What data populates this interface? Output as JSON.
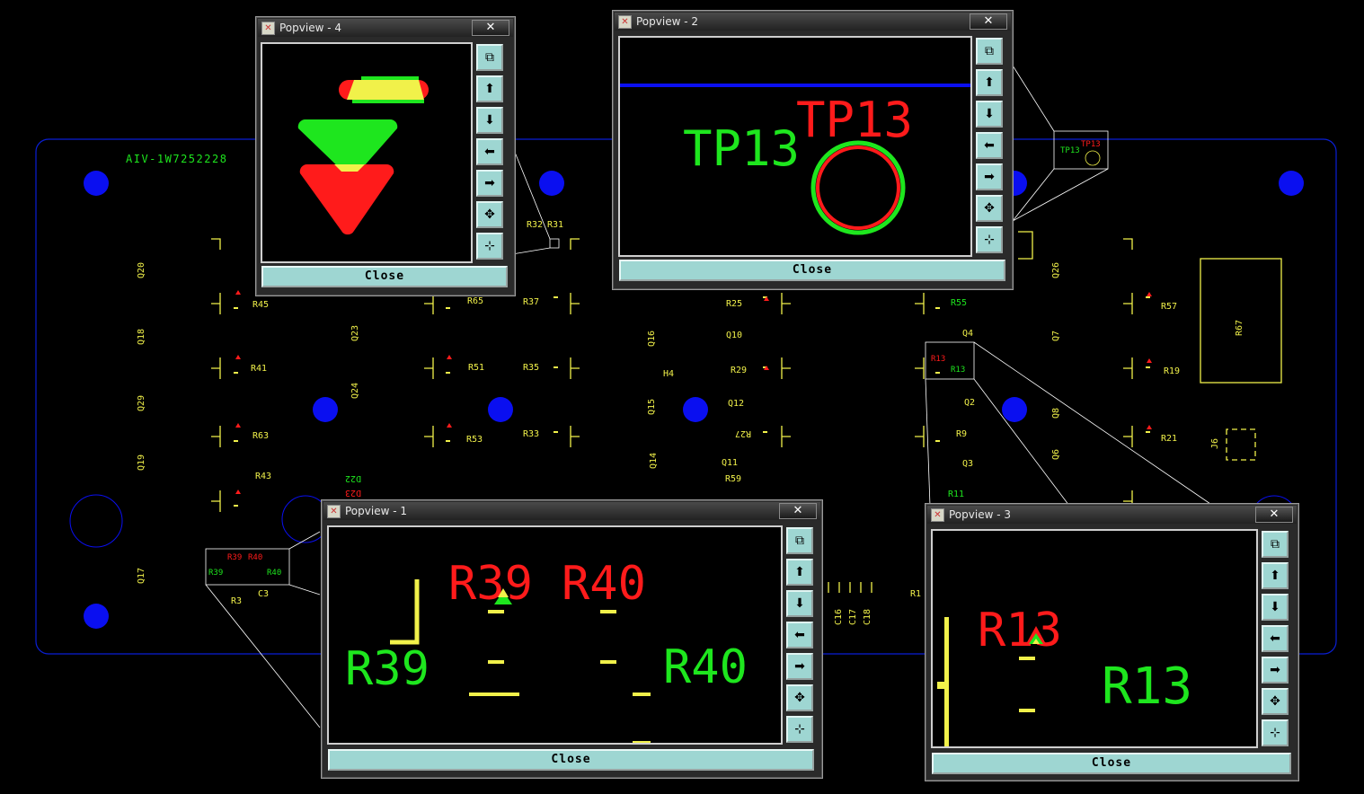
{
  "colors": {
    "outline": "#0a1fd6",
    "silk": "#f1f14a",
    "green": "#1ee61e",
    "red": "#ff1b1b",
    "blue": "#0a0ff0",
    "white": "#ffffff",
    "btn": "#9ed6d2"
  },
  "board": {
    "part_number": "AIV-1W7252228",
    "labels": [
      {
        "t": "Q20",
        "rot": true
      },
      {
        "t": "Q18",
        "rot": true
      },
      {
        "t": "Q29",
        "rot": true
      },
      {
        "t": "Q19",
        "rot": true
      },
      {
        "t": "Q17",
        "rot": true
      },
      {
        "t": "R45"
      },
      {
        "t": "R41"
      },
      {
        "t": "R63"
      },
      {
        "t": "R43"
      },
      {
        "t": "Q23",
        "rot": true
      },
      {
        "t": "Q24",
        "rot": true
      },
      {
        "t": "R65"
      },
      {
        "t": "R51"
      },
      {
        "t": "R53"
      },
      {
        "t": "R37"
      },
      {
        "t": "R35"
      },
      {
        "t": "R33"
      },
      {
        "t": "Q16",
        "rot": true
      },
      {
        "t": "Q15",
        "rot": true
      },
      {
        "t": "Q14",
        "rot": true
      },
      {
        "t": "H4"
      },
      {
        "t": "R25"
      },
      {
        "t": "Q10"
      },
      {
        "t": "R29"
      },
      {
        "t": "Q12"
      },
      {
        "t": "R27"
      },
      {
        "t": "Q11"
      },
      {
        "t": "R59"
      },
      {
        "t": "R55"
      },
      {
        "t": "Q4"
      },
      {
        "t": "Q2"
      },
      {
        "t": "R9"
      },
      {
        "t": "Q3"
      },
      {
        "t": "R11"
      },
      {
        "t": "Q7",
        "rot": true
      },
      {
        "t": "Q8",
        "rot": true
      },
      {
        "t": "Q6",
        "rot": true
      },
      {
        "t": "Q26",
        "rot": true
      },
      {
        "t": "R57"
      },
      {
        "t": "R19"
      },
      {
        "t": "R21"
      },
      {
        "t": "R67"
      },
      {
        "t": "J6",
        "rot": true
      },
      {
        "t": "C3"
      },
      {
        "t": "R3"
      },
      {
        "t": "C16"
      },
      {
        "t": "C17"
      },
      {
        "t": "C18"
      },
      {
        "t": "R1"
      },
      {
        "t": "R32"
      },
      {
        "t": "R31"
      },
      {
        "t": "D22"
      },
      {
        "t": "D23"
      }
    ],
    "zoom_labels": {
      "r13_red": "R13",
      "r13_green": "R13",
      "r39_red": "R39",
      "r40_red": "R40",
      "r39_green": "R39",
      "r40_green": "R40",
      "tp13_green": "TP13",
      "tp13_red": "TP13"
    }
  },
  "windows": [
    {
      "id": "pv4",
      "title": "Popview - 4",
      "close_label": "Close",
      "close_x": "✕"
    },
    {
      "id": "pv2",
      "title": "Popview - 2",
      "close_label": "Close",
      "close_x": "✕",
      "labels": {
        "green": "TP13",
        "red": "TP13"
      }
    },
    {
      "id": "pv1",
      "title": "Popview - 1",
      "close_label": "Close",
      "close_x": "✕",
      "labels": {
        "red1": "R39",
        "red2": "R40",
        "green1": "R39",
        "green2": "R40"
      }
    },
    {
      "id": "pv3",
      "title": "Popview - 3",
      "close_label": "Close",
      "close_x": "✕",
      "labels": {
        "red": "R13",
        "green": "R13"
      }
    }
  ],
  "toolbar": {
    "buttons": [
      {
        "icon": "zoom-window-icon",
        "glyph": "⧉"
      },
      {
        "icon": "pan-up-icon",
        "glyph": "⬆"
      },
      {
        "icon": "pan-down-icon",
        "glyph": "⬇"
      },
      {
        "icon": "pan-left-icon",
        "glyph": "⬅"
      },
      {
        "icon": "pan-right-icon",
        "glyph": "➡"
      },
      {
        "icon": "zoom-out-icon",
        "glyph": "✥"
      },
      {
        "icon": "zoom-in-icon",
        "glyph": "⊹"
      }
    ]
  }
}
